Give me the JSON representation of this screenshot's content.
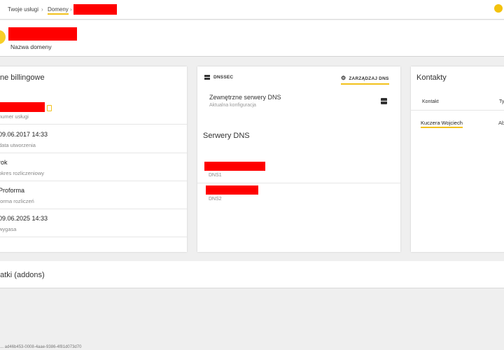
{
  "breadcrumb": {
    "item1": "Twoje usługi",
    "separator": "›",
    "item2": "Domeny"
  },
  "domain": {
    "subtitle": "Nazwa domeny"
  },
  "billing": {
    "title": "ne billingowe",
    "rows": [
      {
        "value": "",
        "label": "numer usługi"
      },
      {
        "value": "09.06.2017 14:33",
        "label": "data utworzenia"
      },
      {
        "value": "rok",
        "label": "okres rozliczeniowy"
      },
      {
        "value": "Proforma",
        "label": "forma rozliczeń"
      },
      {
        "value": "09.06.2025 14:33",
        "label": "wygasa"
      }
    ]
  },
  "dns": {
    "tab_dnssec": "DNSSEC",
    "tab_manage": "ZARZĄDZAJ DNS",
    "external_title": "Zewnętrzne serwery DNS",
    "external_sub": "Aktualna konfiguracja",
    "servers_title": "Serwery DNS",
    "servers": [
      {
        "label": "DNS1"
      },
      {
        "label": "DNS2"
      }
    ]
  },
  "contacts": {
    "title": "Kontakty",
    "col_contact": "Kontakt",
    "col_type": "Ty",
    "name": "Kuczera Wojciech",
    "type": "Ab"
  },
  "addons": {
    "title": "datki (addons)"
  },
  "footer": {
    "text": "... ad46b453-0008-4aae-9386-4f81d073d70"
  },
  "colors": {
    "accent": "#f2c11c",
    "redaction": "#ff0000"
  }
}
